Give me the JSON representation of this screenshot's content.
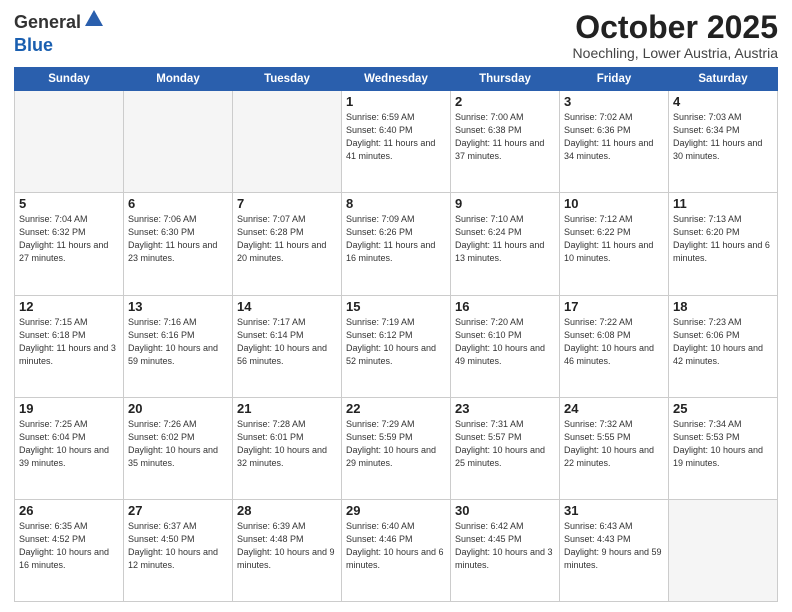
{
  "header": {
    "logo_general": "General",
    "logo_blue": "Blue",
    "month": "October 2025",
    "location": "Noechling, Lower Austria, Austria"
  },
  "weekdays": [
    "Sunday",
    "Monday",
    "Tuesday",
    "Wednesday",
    "Thursday",
    "Friday",
    "Saturday"
  ],
  "weeks": [
    [
      {
        "day": "",
        "empty": true
      },
      {
        "day": "",
        "empty": true
      },
      {
        "day": "",
        "empty": true
      },
      {
        "day": "1",
        "sunrise": "6:59 AM",
        "sunset": "6:40 PM",
        "daylight": "11 hours and 41 minutes."
      },
      {
        "day": "2",
        "sunrise": "7:00 AM",
        "sunset": "6:38 PM",
        "daylight": "11 hours and 37 minutes."
      },
      {
        "day": "3",
        "sunrise": "7:02 AM",
        "sunset": "6:36 PM",
        "daylight": "11 hours and 34 minutes."
      },
      {
        "day": "4",
        "sunrise": "7:03 AM",
        "sunset": "6:34 PM",
        "daylight": "11 hours and 30 minutes."
      }
    ],
    [
      {
        "day": "5",
        "sunrise": "7:04 AM",
        "sunset": "6:32 PM",
        "daylight": "11 hours and 27 minutes."
      },
      {
        "day": "6",
        "sunrise": "7:06 AM",
        "sunset": "6:30 PM",
        "daylight": "11 hours and 23 minutes."
      },
      {
        "day": "7",
        "sunrise": "7:07 AM",
        "sunset": "6:28 PM",
        "daylight": "11 hours and 20 minutes."
      },
      {
        "day": "8",
        "sunrise": "7:09 AM",
        "sunset": "6:26 PM",
        "daylight": "11 hours and 16 minutes."
      },
      {
        "day": "9",
        "sunrise": "7:10 AM",
        "sunset": "6:24 PM",
        "daylight": "11 hours and 13 minutes."
      },
      {
        "day": "10",
        "sunrise": "7:12 AM",
        "sunset": "6:22 PM",
        "daylight": "11 hours and 10 minutes."
      },
      {
        "day": "11",
        "sunrise": "7:13 AM",
        "sunset": "6:20 PM",
        "daylight": "11 hours and 6 minutes."
      }
    ],
    [
      {
        "day": "12",
        "sunrise": "7:15 AM",
        "sunset": "6:18 PM",
        "daylight": "11 hours and 3 minutes."
      },
      {
        "day": "13",
        "sunrise": "7:16 AM",
        "sunset": "6:16 PM",
        "daylight": "10 hours and 59 minutes."
      },
      {
        "day": "14",
        "sunrise": "7:17 AM",
        "sunset": "6:14 PM",
        "daylight": "10 hours and 56 minutes."
      },
      {
        "day": "15",
        "sunrise": "7:19 AM",
        "sunset": "6:12 PM",
        "daylight": "10 hours and 52 minutes."
      },
      {
        "day": "16",
        "sunrise": "7:20 AM",
        "sunset": "6:10 PM",
        "daylight": "10 hours and 49 minutes."
      },
      {
        "day": "17",
        "sunrise": "7:22 AM",
        "sunset": "6:08 PM",
        "daylight": "10 hours and 46 minutes."
      },
      {
        "day": "18",
        "sunrise": "7:23 AM",
        "sunset": "6:06 PM",
        "daylight": "10 hours and 42 minutes."
      }
    ],
    [
      {
        "day": "19",
        "sunrise": "7:25 AM",
        "sunset": "6:04 PM",
        "daylight": "10 hours and 39 minutes."
      },
      {
        "day": "20",
        "sunrise": "7:26 AM",
        "sunset": "6:02 PM",
        "daylight": "10 hours and 35 minutes."
      },
      {
        "day": "21",
        "sunrise": "7:28 AM",
        "sunset": "6:01 PM",
        "daylight": "10 hours and 32 minutes."
      },
      {
        "day": "22",
        "sunrise": "7:29 AM",
        "sunset": "5:59 PM",
        "daylight": "10 hours and 29 minutes."
      },
      {
        "day": "23",
        "sunrise": "7:31 AM",
        "sunset": "5:57 PM",
        "daylight": "10 hours and 25 minutes."
      },
      {
        "day": "24",
        "sunrise": "7:32 AM",
        "sunset": "5:55 PM",
        "daylight": "10 hours and 22 minutes."
      },
      {
        "day": "25",
        "sunrise": "7:34 AM",
        "sunset": "5:53 PM",
        "daylight": "10 hours and 19 minutes."
      }
    ],
    [
      {
        "day": "26",
        "sunrise": "6:35 AM",
        "sunset": "4:52 PM",
        "daylight": "10 hours and 16 minutes."
      },
      {
        "day": "27",
        "sunrise": "6:37 AM",
        "sunset": "4:50 PM",
        "daylight": "10 hours and 12 minutes."
      },
      {
        "day": "28",
        "sunrise": "6:39 AM",
        "sunset": "4:48 PM",
        "daylight": "10 hours and 9 minutes."
      },
      {
        "day": "29",
        "sunrise": "6:40 AM",
        "sunset": "4:46 PM",
        "daylight": "10 hours and 6 minutes."
      },
      {
        "day": "30",
        "sunrise": "6:42 AM",
        "sunset": "4:45 PM",
        "daylight": "10 hours and 3 minutes."
      },
      {
        "day": "31",
        "sunrise": "6:43 AM",
        "sunset": "4:43 PM",
        "daylight": "9 hours and 59 minutes."
      },
      {
        "day": "",
        "empty": true
      }
    ]
  ]
}
